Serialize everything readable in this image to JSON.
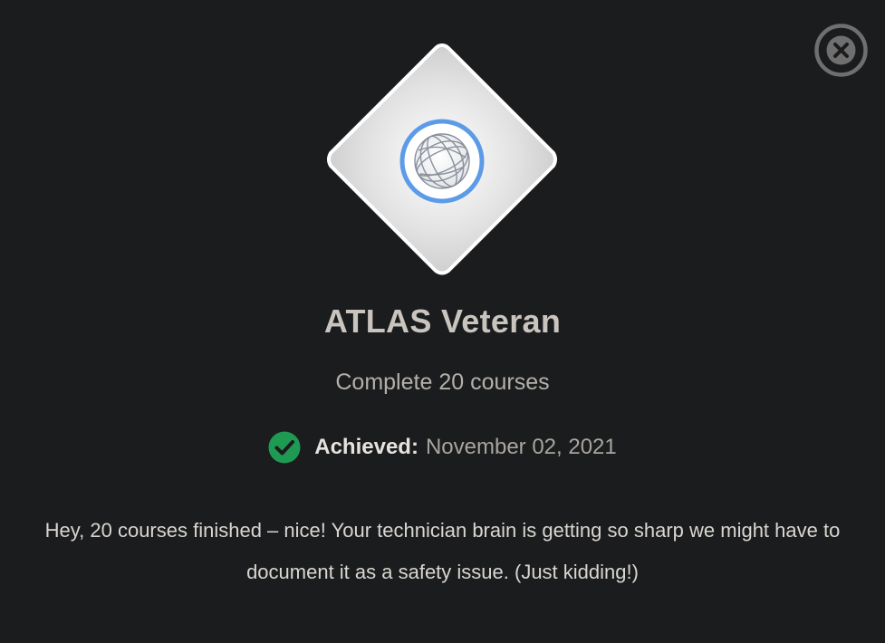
{
  "modal": {
    "close_icon": "close-circle-icon",
    "badge": {
      "icon": "globe-icon",
      "colors": {
        "ring": "#5b9be8",
        "plate": "#d8d8d8",
        "plate_edge": "#ffffff"
      }
    },
    "title": "ATLAS Veteran",
    "subtitle": "Complete 20 courses",
    "achieved": {
      "icon": "check-circle-icon",
      "label": "Achieved:",
      "date": "November 02, 2021",
      "icon_color": "#1f9a52"
    },
    "message": "Hey, 20 courses finished – nice! Your technician brain is getting so sharp we might have to document it as a safety issue. (Just kidding!)"
  },
  "colors": {
    "background": "#1b1c1e",
    "close_icon": "#6f6f70"
  }
}
